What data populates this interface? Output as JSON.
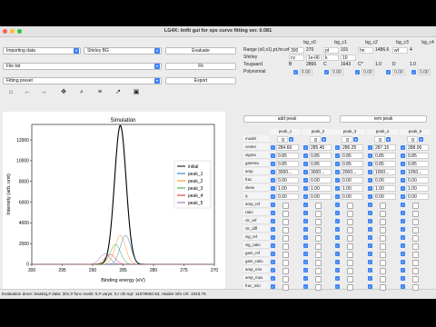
{
  "window": {
    "title": "LG4X: lmfit gui for xps curve fitting ver. 0.081"
  },
  "combos": {
    "importing": "Importing data",
    "bg_type": "Shirley BG",
    "file_list": "File list",
    "fitting_preset": "Fitting preset"
  },
  "buttons": {
    "evaluate": "Evaluate",
    "fit": "Fit",
    "export": "Export",
    "add_peak": "add peak",
    "rem_peak": "rem peak"
  },
  "toolbar": [
    "home-icon",
    "back-icon",
    "forward-icon",
    "pan-icon",
    "zoom-icon",
    "configure-icon",
    "axes-icon",
    "save-icon"
  ],
  "bg_table": {
    "headers": [
      "bg_c0",
      "bg_c1",
      "bg_c2",
      "bg_c3",
      "bg_c4"
    ],
    "rows": [
      {
        "label": "Range (x0,x1),pt,hn,wf",
        "cells": [
          "300",
          "270",
          "pt",
          "101",
          "hn",
          "1486.6",
          "wf",
          "4"
        ]
      },
      {
        "label": "Shirley",
        "cells": [
          "cv",
          "1e-06",
          "k",
          "10"
        ]
      },
      {
        "label": "Tougaard",
        "cells": [
          "B",
          "2866",
          "C",
          "1643",
          "C*",
          "1.0",
          "D",
          "1.0"
        ]
      },
      {
        "label": "Polynomial",
        "cells": [
          "0.00",
          "0.00",
          "0.00",
          "0.00",
          "0.00"
        ]
      }
    ]
  },
  "peak_table": {
    "headers": [
      "peak_1",
      "peak_2",
      "peak_3",
      "peak_4",
      "peak_5"
    ],
    "model_value": "g",
    "rows": [
      {
        "label": "model",
        "values": [
          "g",
          "g",
          "g",
          "g",
          "g"
        ]
      },
      {
        "label": "center",
        "values": [
          "284.60",
          "285.45",
          "286.25",
          "287.15",
          "288.00"
        ]
      },
      {
        "label": "sigma",
        "values": [
          "0.85",
          "0.85",
          "0.85",
          "0.85",
          "0.85"
        ]
      },
      {
        "label": "gamma",
        "values": [
          "0.85",
          "0.85",
          "0.85",
          "0.85",
          "0.85"
        ]
      },
      {
        "label": "amp",
        "values": [
          "3000...",
          "3000...",
          "2000...",
          "1000...",
          "1050..."
        ]
      },
      {
        "label": "frac",
        "values": [
          "0.00",
          "0.00",
          "0.00",
          "0.00",
          "0.00"
        ]
      },
      {
        "label": "skew",
        "values": [
          "1.00",
          "1.00",
          "1.00",
          "1.00",
          "1.00"
        ]
      },
      {
        "label": "q",
        "values": [
          "0.00",
          "0.00",
          "0.00",
          "0.00",
          "0.00"
        ]
      },
      {
        "label": "amp_ref",
        "values": []
      },
      {
        "label": "ratio",
        "values": []
      },
      {
        "label": "ctr_ref",
        "values": []
      },
      {
        "label": "ctr_diff",
        "values": []
      },
      {
        "label": "sig_ref",
        "values": []
      },
      {
        "label": "sig_ratio",
        "values": []
      },
      {
        "label": "gam_ref",
        "values": []
      },
      {
        "label": "gam_ratio",
        "values": []
      },
      {
        "label": "amp_min",
        "values": []
      },
      {
        "label": "amp_max",
        "values": []
      },
      {
        "label": "frac_min",
        "values": []
      }
    ]
  },
  "status": "Evaluation done: leastsq,# data: 301,# func evals: 0,# varys: 0,r chi-sqr: 11678650.53, Akaike info crit: 1043.76",
  "chart_data": {
    "type": "line",
    "title": "Simulation",
    "xlabel": "Binding energy (eV)",
    "ylabel": "Intensity (arb. unit)",
    "xlim": [
      300,
      270
    ],
    "ylim": [
      0,
      13500
    ],
    "xticks": [
      300,
      295,
      290,
      285,
      280,
      275,
      270
    ],
    "yticks": [
      0,
      2000,
      4000,
      6000,
      8000,
      10000,
      12000
    ],
    "legend_position": "right",
    "series": [
      {
        "name": "initial",
        "color": "#000000",
        "center": 285.45,
        "amp": 13400,
        "sigma": 0.95
      },
      {
        "name": "peak_1",
        "color": "#1f77b4",
        "center": 284.6,
        "amp": 2800,
        "sigma": 0.85
      },
      {
        "name": "peak_2",
        "color": "#ff7f0e",
        "center": 285.45,
        "amp": 2800,
        "sigma": 0.85
      },
      {
        "name": "peak_3",
        "color": "#2ca02c",
        "center": 286.25,
        "amp": 1900,
        "sigma": 0.85
      },
      {
        "name": "peak_4",
        "color": "#d62728",
        "center": 287.15,
        "amp": 950,
        "sigma": 0.85
      },
      {
        "name": "peak_5",
        "color": "#9467bd",
        "center": 288.0,
        "amp": 1000,
        "sigma": 0.85
      }
    ]
  }
}
